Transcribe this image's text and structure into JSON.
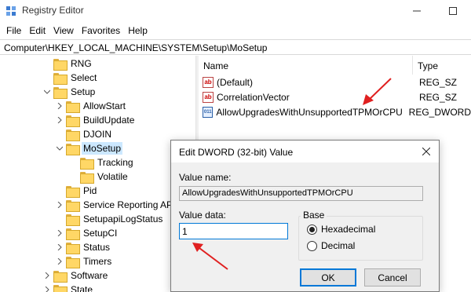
{
  "window": {
    "title": "Registry Editor"
  },
  "menu": [
    "File",
    "Edit",
    "View",
    "Favorites",
    "Help"
  ],
  "address": "Computer\\HKEY_LOCAL_MACHINE\\SYSTEM\\Setup\\MoSetup",
  "tree": [
    {
      "label": "RNG",
      "indent": 0,
      "chevron": "",
      "selected": false
    },
    {
      "label": "Select",
      "indent": 0,
      "chevron": "",
      "selected": false
    },
    {
      "label": "Setup",
      "indent": 0,
      "chevron": "down",
      "selected": false
    },
    {
      "label": "AllowStart",
      "indent": 1,
      "chevron": "right",
      "selected": false
    },
    {
      "label": "BuildUpdate",
      "indent": 1,
      "chevron": "right",
      "selected": false
    },
    {
      "label": "DJOIN",
      "indent": 1,
      "chevron": "",
      "selected": false
    },
    {
      "label": "MoSetup",
      "indent": 1,
      "chevron": "down",
      "selected": true
    },
    {
      "label": "Tracking",
      "indent": 2,
      "chevron": "",
      "selected": false
    },
    {
      "label": "Volatile",
      "indent": 2,
      "chevron": "",
      "selected": false
    },
    {
      "label": "Pid",
      "indent": 1,
      "chevron": "",
      "selected": false
    },
    {
      "label": "Service Reporting API",
      "indent": 1,
      "chevron": "right",
      "selected": false
    },
    {
      "label": "SetupapiLogStatus",
      "indent": 1,
      "chevron": "",
      "selected": false
    },
    {
      "label": "SetupCI",
      "indent": 1,
      "chevron": "right",
      "selected": false
    },
    {
      "label": "Status",
      "indent": 1,
      "chevron": "right",
      "selected": false
    },
    {
      "label": "Timers",
      "indent": 1,
      "chevron": "right",
      "selected": false
    },
    {
      "label": "Software",
      "indent": 0,
      "chevron": "right",
      "selected": false
    },
    {
      "label": "State",
      "indent": 0,
      "chevron": "right",
      "selected": false
    }
  ],
  "columns": {
    "name": "Name",
    "type": "Type"
  },
  "values": [
    {
      "name": "(Default)",
      "type": "REG_SZ",
      "icon": "string-value-icon",
      "badge": "ab"
    },
    {
      "name": "CorrelationVector",
      "type": "REG_SZ",
      "icon": "string-value-icon",
      "badge": "ab"
    },
    {
      "name": "AllowUpgradesWithUnsupportedTPMOrCPU",
      "type": "REG_DWORD",
      "icon": "dword-value-icon",
      "badge": "011"
    }
  ],
  "dialog": {
    "title": "Edit DWORD (32-bit) Value",
    "value_name_label": "Value name:",
    "value_name": "AllowUpgradesWithUnsupportedTPMOrCPU",
    "value_data_label": "Value data:",
    "value_data": "1",
    "base_label": "Base",
    "hex_label": "Hexadecimal",
    "dec_label": "Decimal",
    "base_selected": "Hexadecimal",
    "ok_label": "OK",
    "cancel_label": "Cancel"
  },
  "colors": {
    "selection": "#cce8ff",
    "accent": "#0078d7",
    "arrow": "#e02020"
  }
}
